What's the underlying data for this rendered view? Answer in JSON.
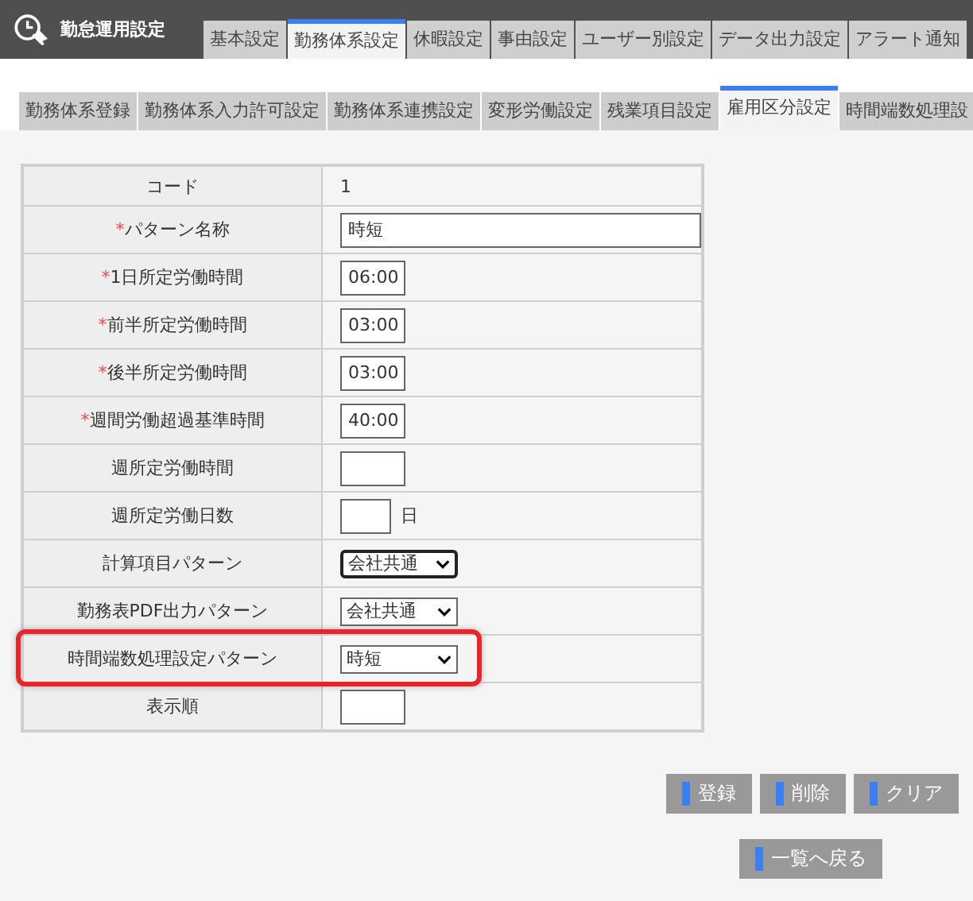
{
  "app": {
    "title": "勤怠運用設定"
  },
  "tabs": [
    {
      "label": "基本設定",
      "selected": false
    },
    {
      "label": "勤務体系設定",
      "selected": true
    },
    {
      "label": "休暇設定",
      "selected": false
    },
    {
      "label": "事由設定",
      "selected": false
    },
    {
      "label": "ユーザー別設定",
      "selected": false
    },
    {
      "label": "データ出力設定",
      "selected": false
    },
    {
      "label": "アラート通知",
      "selected": false
    }
  ],
  "subtabs": [
    {
      "label": "勤務体系登録",
      "selected": false
    },
    {
      "label": "勤務体系入力許可設定",
      "selected": false
    },
    {
      "label": "勤務体系連携設定",
      "selected": false
    },
    {
      "label": "変形労働設定",
      "selected": false
    },
    {
      "label": "残業項目設定",
      "selected": false
    },
    {
      "label": "雇用区分設定",
      "selected": true
    },
    {
      "label": "時間端数処理設",
      "selected": false
    }
  ],
  "form": [
    {
      "kind": "text",
      "label": "コード",
      "required": false,
      "value": "1",
      "highlighted": false
    },
    {
      "kind": "textbox",
      "label": "パターン名称",
      "required": true,
      "value": "時短",
      "highlighted": false
    },
    {
      "kind": "timebox",
      "label": "1日所定労働時間",
      "required": true,
      "value": "06:00",
      "highlighted": false
    },
    {
      "kind": "timebox",
      "label": "前半所定労働時間",
      "required": true,
      "value": "03:00",
      "highlighted": false
    },
    {
      "kind": "timebox",
      "label": "後半所定労働時間",
      "required": true,
      "value": "03:00",
      "highlighted": false
    },
    {
      "kind": "timebox",
      "label": "週間労働超過基準時間",
      "required": true,
      "value": "40:00",
      "highlighted": false
    },
    {
      "kind": "timebox",
      "label": "週所定労働時間",
      "required": false,
      "highlighted": false
    },
    {
      "kind": "countbox",
      "label": "週所定労働日数",
      "required": false,
      "suffix": "日",
      "highlighted": false
    },
    {
      "kind": "select",
      "label": "計算項目パターン",
      "required": false,
      "value": "会社共通",
      "focused": true,
      "highlighted": false
    },
    {
      "kind": "select",
      "label": "勤務表PDF出力パターン",
      "required": false,
      "value": "会社共通",
      "focused": false,
      "highlighted": false
    },
    {
      "kind": "select",
      "label": "時間端数処理設定パターン",
      "required": false,
      "value": "時短",
      "focused": false,
      "highlighted": true
    },
    {
      "kind": "timebox",
      "label": "表示順",
      "required": false,
      "highlighted": false
    }
  ],
  "required_mark": "*",
  "buttons": [
    "登録",
    "削除",
    "クリア"
  ],
  "back_button": "一覧へ戻る"
}
